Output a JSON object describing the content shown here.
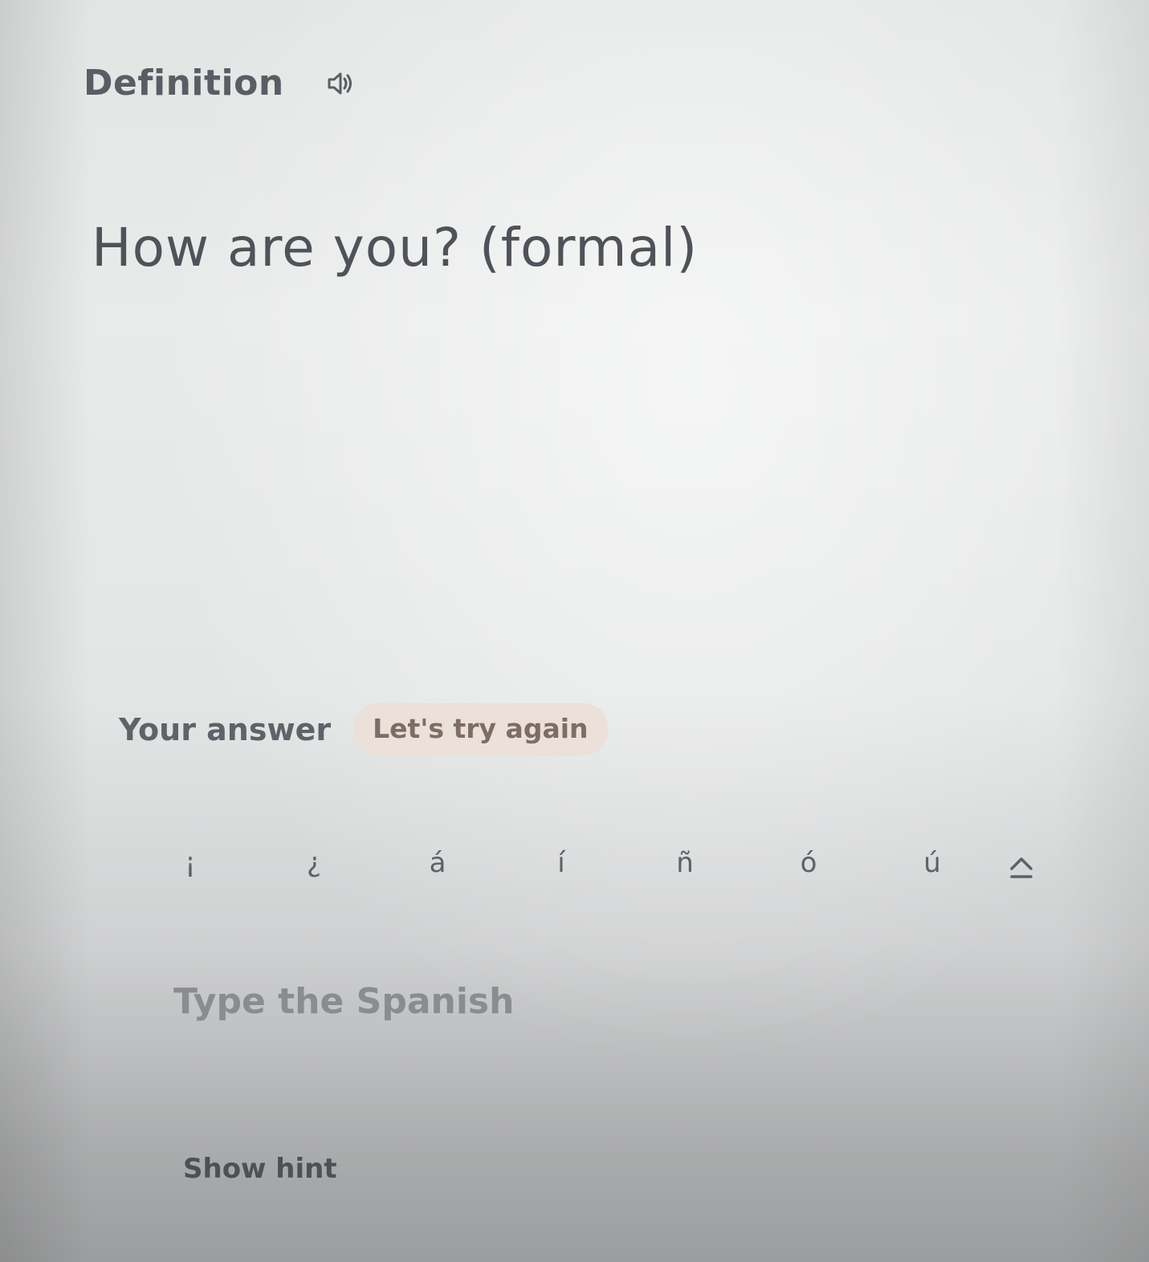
{
  "header": {
    "title": "Definition",
    "audio_icon": "speaker-icon"
  },
  "term": {
    "text": "How are you? (formal)"
  },
  "answer": {
    "label": "Your answer",
    "status": "Let's try again"
  },
  "special_characters": [
    "¡",
    "¿",
    "á",
    "í",
    "ñ",
    "ó",
    "ú"
  ],
  "shift_icon": "caps-shift-icon",
  "input": {
    "value": "",
    "placeholder": "Type the Spanish"
  },
  "hint": {
    "label": "Show hint"
  },
  "colors": {
    "status_badge_bg": "#ebe0da",
    "status_badge_text": "#7e6d64",
    "text_primary": "#4f5258"
  }
}
